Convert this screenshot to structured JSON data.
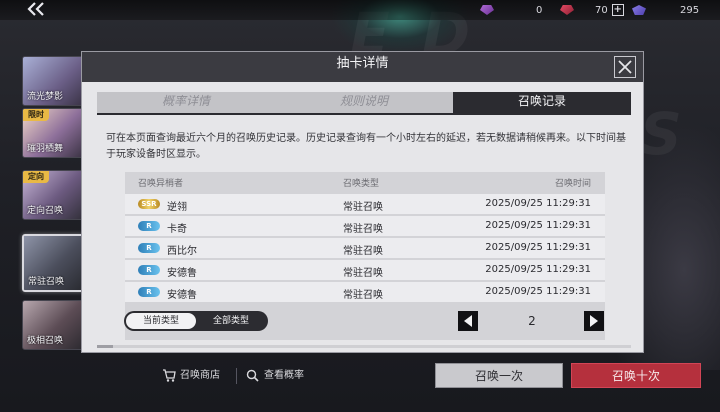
{
  "topbar": {
    "currency_1": "0",
    "currency_2": "70",
    "currency_3": "295"
  },
  "sidebar": {
    "items": [
      {
        "label": "流光梦影",
        "tag": ""
      },
      {
        "label": "璀羽栖舞",
        "tag": "限时"
      },
      {
        "label": "定向召唤",
        "tag": "定向"
      },
      {
        "label": "常驻召唤",
        "tag": ""
      },
      {
        "label": "极相召唤",
        "tag": ""
      }
    ]
  },
  "dialog": {
    "title": "抽卡详情",
    "tabs": [
      {
        "label": "概率详情",
        "active": false
      },
      {
        "label": "规则说明",
        "active": false
      },
      {
        "label": "召唤记录",
        "active": true
      }
    ],
    "description": "可在本页面查询最近六个月的召唤历史记录。历史记录查询有一个小时左右的延迟，若无数据请稍候再来。以下时间基于玩家设备时区显示。",
    "table": {
      "headers": {
        "col1": "召唤异梢者",
        "col2": "召唤类型",
        "col3": "召唤时间"
      },
      "rows": [
        {
          "rank": "SSR",
          "name": "逆翎",
          "type": "常驻召唤",
          "time": "2025/09/25 11:29:31"
        },
        {
          "rank": "R",
          "name": "卡奇",
          "type": "常驻召唤",
          "time": "2025/09/25 11:29:31"
        },
        {
          "rank": "R",
          "name": "西比尔",
          "type": "常驻召唤",
          "time": "2025/09/25 11:29:31"
        },
        {
          "rank": "R",
          "name": "安德鲁",
          "type": "常驻召唤",
          "time": "2025/09/25 11:29:31"
        },
        {
          "rank": "R",
          "name": "安德鲁",
          "type": "常驻召唤",
          "time": "2025/09/25 11:29:31"
        }
      ]
    },
    "filter": {
      "current": "当前类型",
      "all": "全部类型"
    },
    "page": "2"
  },
  "bottom": {
    "shop": "召唤商店",
    "rates": "查看概率",
    "summon_one": "召唤一次",
    "summon_ten": "召唤十次"
  },
  "colors": {
    "dialog_bg": "#e6e6e9",
    "header_dark": "#3b3b41",
    "accent_red": "#b5303d",
    "ssr_gold": "#f1d36a",
    "r_blue": "#4aa3db"
  }
}
